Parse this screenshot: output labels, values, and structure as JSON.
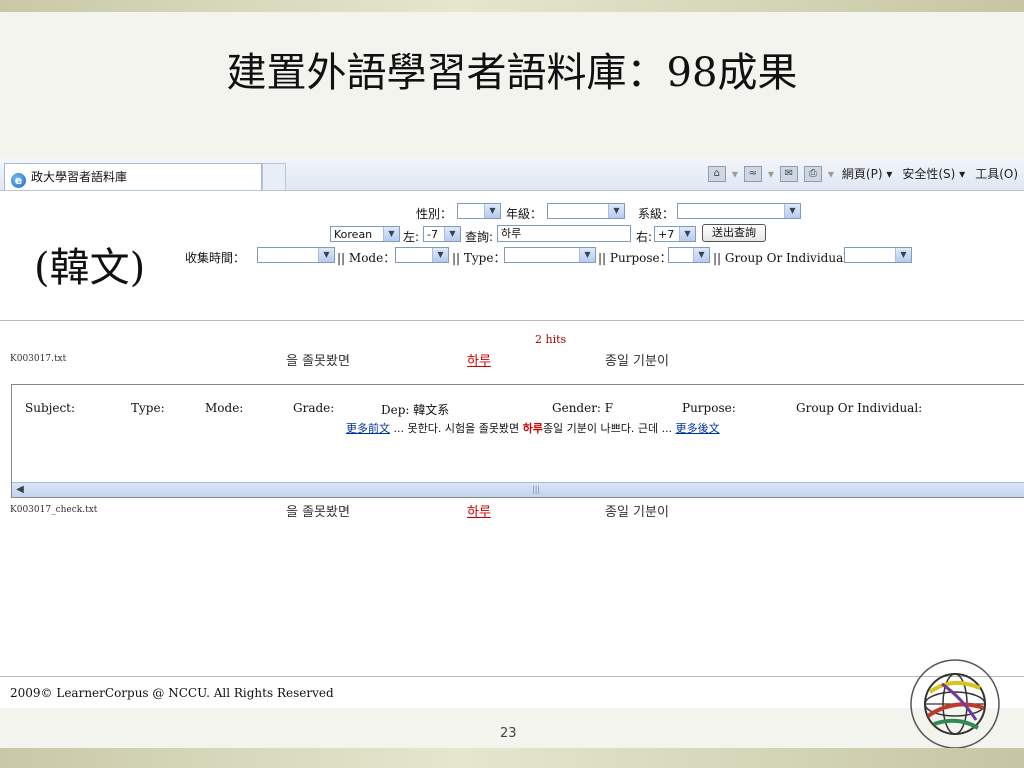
{
  "slide": {
    "title": "建置外語學習者語料庫：98成果",
    "section_label": "(韓文)",
    "page_number": "23",
    "footer": "2009© LearnerCorpus @ NCCU. All Rights Reserved"
  },
  "browser": {
    "tab_title": "政大學習者語料庫",
    "toolbar": {
      "home": "home-icon",
      "feeds": "rss-icon",
      "mail": "mail-icon",
      "print": "print-icon",
      "page_menu": "網頁(P)",
      "safety_menu": "安全性(S)",
      "tools_menu": "工具(O)"
    }
  },
  "search_form": {
    "gender_label": "性別：",
    "gender_value": "",
    "grade_label": "年級：",
    "grade_value": "",
    "dept_label": "系級：",
    "dept_value": "",
    "language_value": "Korean",
    "left_label": "左:",
    "left_value": "-7",
    "query_label": "查詢:",
    "query_value": "하루",
    "right_label": "右:",
    "right_value": "+7",
    "submit_label": "送出查詢",
    "collect_time_label": "收集時間：",
    "collect_time_value": "",
    "mode_label": "|| Mode：",
    "mode_value": "",
    "type_label": "|| Type：",
    "type_value": "",
    "purpose_label": "|| Purpose：",
    "purpose_value": "",
    "group_label": "|| Group Or Individual：",
    "group_value": ""
  },
  "results": {
    "hits": "2 hits",
    "rows": [
      {
        "file": "K003017.txt",
        "left": "을 졸못봤면",
        "keyword": "하루",
        "right": "종일 기분이"
      },
      {
        "file": "K003017_check.txt",
        "left": "을 졸못봤면",
        "keyword": "하루",
        "right": "종일 기분이"
      }
    ],
    "detail": {
      "subject_label": "Subject:",
      "type_label": "Type:",
      "mode_label": "Mode:",
      "grade_label": "Grade:",
      "dep_label": "Dep: 韓文系",
      "gender_label": "Gender: F",
      "purpose_label": "Purpose:",
      "group_label": "Group Or Individual:",
      "more_before": "更多前文",
      "context_left": "... 못한다. 시험을 졸못봤면",
      "keyword": "하루",
      "context_right": "종일 기분이 나쁘다. 근데 ...",
      "more_after": "更多後文"
    }
  }
}
